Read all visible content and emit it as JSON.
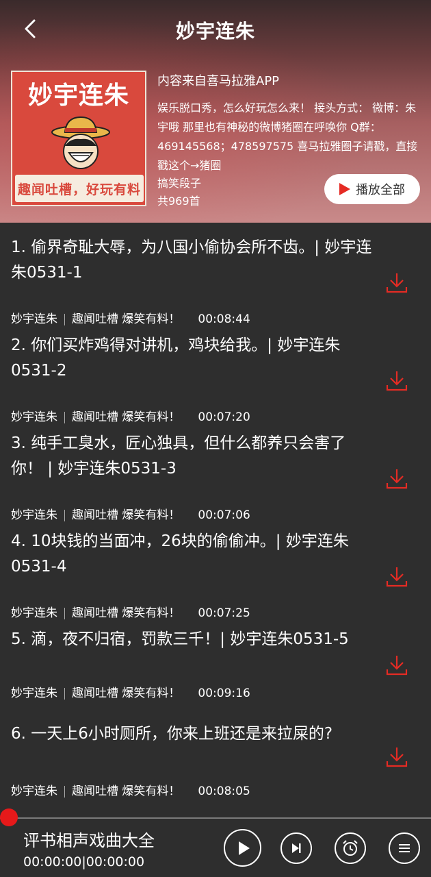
{
  "topbar": {
    "title": "妙宇连朱",
    "back_icon": "chevron-left-icon"
  },
  "album": {
    "cover_title": "妙宇连朱",
    "cover_slogan": "趣闻吐槽，好玩有料",
    "source": "内容来自喜马拉雅APP",
    "description": "娱乐脱口秀，怎么好玩怎么来！ 接头方式： 微博：朱宇哦 那里也有神秘的微博猪圈在呼唤你 Q群：469145568；478597575 喜马拉雅圈子请戳，直接戳这个→猪圈",
    "category": "搞笑段子",
    "count": "共969首",
    "play_all_label": "播放全部",
    "accent": "#e52b24"
  },
  "tracks": [
    {
      "title": "1. 偷界奇耻大辱，为八国小偷协会所不齿。| 妙宇连朱0531-1",
      "author": "妙宇连朱",
      "tagline": "趣闻吐槽 爆笑有料！",
      "duration": "00:08:44"
    },
    {
      "title": "2. 你们买炸鸡得对讲机，鸡块给我。| 妙宇连朱0531-2",
      "author": "妙宇连朱",
      "tagline": "趣闻吐槽 爆笑有料！",
      "duration": "00:07:20"
    },
    {
      "title": "3. 纯手工臭水，匠心独具，但什么都养只会害了你！ | 妙宇连朱0531-3",
      "author": "妙宇连朱",
      "tagline": "趣闻吐槽 爆笑有料！",
      "duration": "00:07:06"
    },
    {
      "title": "4. 10块钱的当面冲，26块的偷偷冲。| 妙宇连朱0531-4",
      "author": "妙宇连朱",
      "tagline": "趣闻吐槽 爆笑有料！",
      "duration": "00:07:25"
    },
    {
      "title": "5. 滴，夜不归宿，罚款三千！| 妙宇连朱0531-5",
      "author": "妙宇连朱",
      "tagline": "趣闻吐槽 爆笑有料！",
      "duration": "00:09:16"
    },
    {
      "title": "6. 一天上6小时厕所，你来上班还是来拉屎的?",
      "author": "妙宇连朱",
      "tagline": "趣闻吐槽 爆笑有料！",
      "duration": "00:08:05"
    }
  ],
  "player": {
    "title": "评书相声戏曲大全",
    "time": "00:00:00|00:00:00",
    "progress": 0,
    "icons": [
      "play-icon",
      "next-icon",
      "alarm-icon",
      "playlist-icon"
    ]
  }
}
